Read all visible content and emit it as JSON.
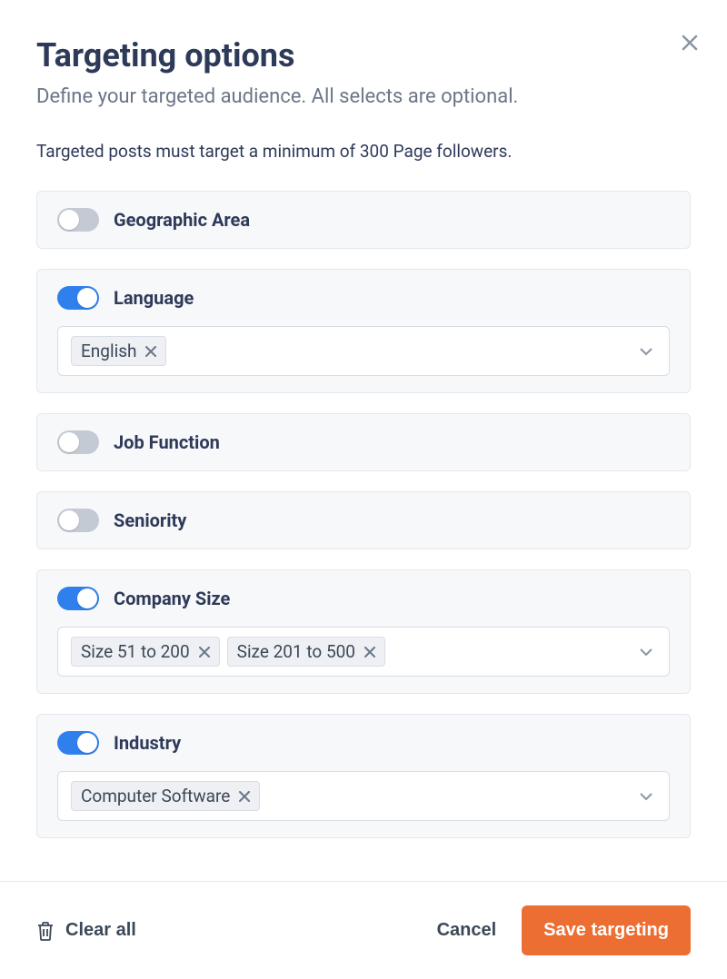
{
  "modal": {
    "title": "Targeting options",
    "subtitle": "Define your targeted audience. All selects are optional.",
    "info": "Targeted posts must target a minimum of 300 Page followers."
  },
  "sections": {
    "geographic": {
      "label": "Geographic Area",
      "enabled": false
    },
    "language": {
      "label": "Language",
      "enabled": true,
      "chips": [
        "English"
      ]
    },
    "jobFunction": {
      "label": "Job Function",
      "enabled": false
    },
    "seniority": {
      "label": "Seniority",
      "enabled": false
    },
    "companySize": {
      "label": "Company Size",
      "enabled": true,
      "chips": [
        "Size 51 to 200",
        "Size 201 to 500"
      ]
    },
    "industry": {
      "label": "Industry",
      "enabled": true,
      "chips": [
        "Computer Software"
      ]
    }
  },
  "footer": {
    "clearAll": "Clear all",
    "cancel": "Cancel",
    "save": "Save targeting"
  }
}
